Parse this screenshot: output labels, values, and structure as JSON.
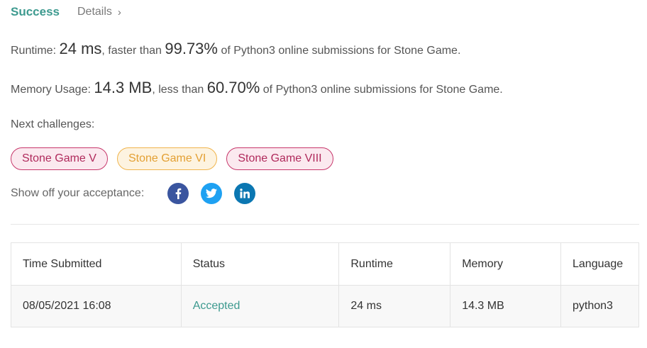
{
  "header": {
    "status": "Success",
    "details_label": "Details",
    "chevron": "›"
  },
  "runtime": {
    "label": "Runtime:",
    "value": "24 ms",
    "comparison": ", faster than",
    "percent": "99.73%",
    "suffix": "of Python3 online submissions for Stone Game."
  },
  "memory": {
    "label": "Memory Usage:",
    "value": "14.3 MB",
    "comparison": ", less than",
    "percent": "60.70%",
    "suffix": "of Python3 online submissions for Stone Game."
  },
  "next_challenges": {
    "label": "Next challenges:",
    "items": [
      {
        "label": "Stone Game V",
        "difficulty": "hard",
        "color": "#c7376b"
      },
      {
        "label": "Stone Game VI",
        "difficulty": "medium",
        "color": "#f0b44c"
      },
      {
        "label": "Stone Game VIII",
        "difficulty": "hard",
        "color": "#c7376b"
      }
    ]
  },
  "share": {
    "label": "Show off your acceptance:",
    "icons": [
      "facebook-icon",
      "twitter-icon",
      "linkedin-icon"
    ]
  },
  "submissions_table": {
    "headers": [
      "Time Submitted",
      "Status",
      "Runtime",
      "Memory",
      "Language"
    ],
    "rows": [
      [
        "08/05/2021 16:08",
        "Accepted",
        "24 ms",
        "14.3 MB",
        "python3"
      ]
    ]
  },
  "colors": {
    "accent": "#3d9a8f",
    "hard": "#c7376b",
    "medium": "#f0b44c",
    "facebook": "#3a559f",
    "twitter": "#1ea1f2",
    "linkedin": "#0b77b2"
  }
}
